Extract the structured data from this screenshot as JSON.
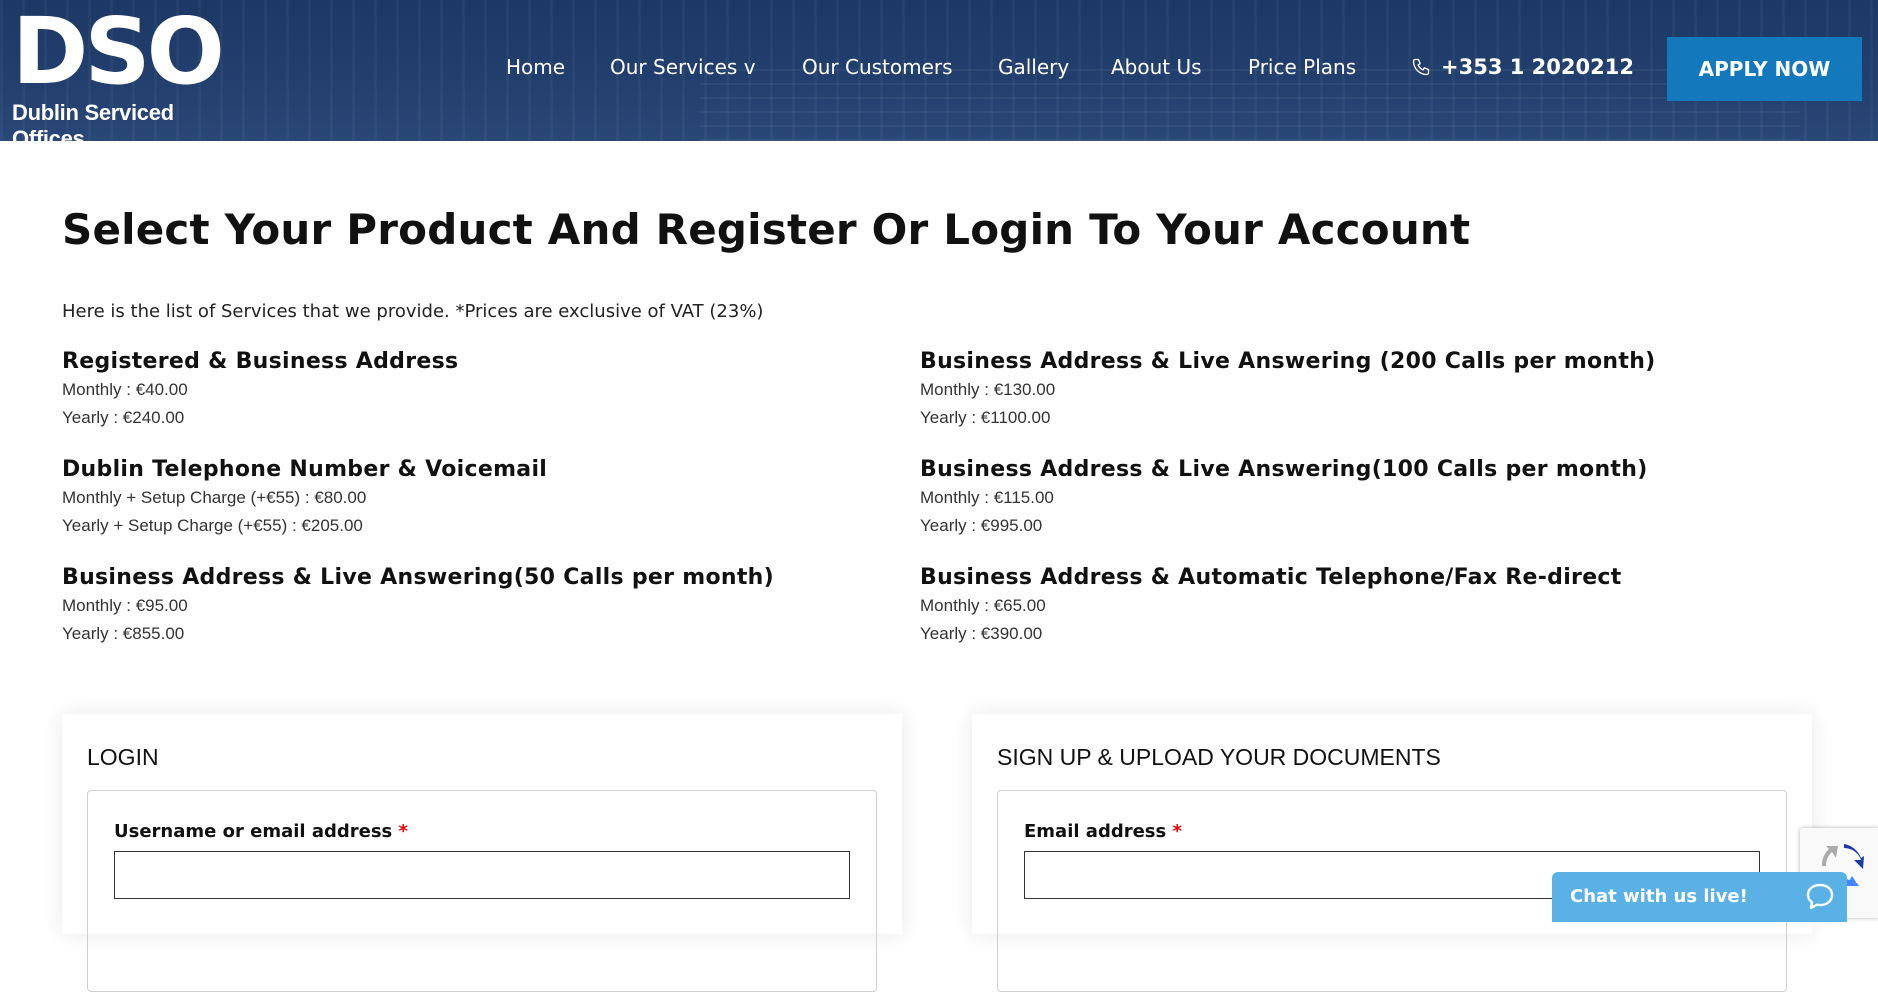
{
  "header": {
    "logo_mark": "DSO",
    "logo_text": "Dublin Serviced Offices",
    "nav": [
      {
        "label": "Home"
      },
      {
        "label": "Our Services v"
      },
      {
        "label": "Our Customers"
      },
      {
        "label": "Gallery"
      },
      {
        "label": "About Us"
      },
      {
        "label": "Price Plans"
      }
    ],
    "phone": "+353 1 2020212",
    "phone_icon": "phone-icon",
    "apply_label": "APPLY NOW"
  },
  "main": {
    "title": "Select Your Product And Register Or Login To Your Account",
    "intro": "Here is the list of Services that we provide. *Prices are exclusive of VAT (23%)",
    "services": [
      {
        "name": "Registered & Business Address",
        "monthly": "Monthly : €40.00",
        "yearly": "Yearly : €240.00"
      },
      {
        "name": "Business Address & Live Answering (200 Calls per month)",
        "monthly": "Monthly : €130.00",
        "yearly": "Yearly : €1100.00"
      },
      {
        "name": "Dublin Telephone Number & Voicemail",
        "monthly": "Monthly + Setup Charge (+€55) : €80.00",
        "yearly": "Yearly + Setup Charge (+€55) : €205.00"
      },
      {
        "name": "Business Address & Live Answering(100 Calls per month)",
        "monthly": "Monthly : €115.00",
        "yearly": "Yearly : €995.00"
      },
      {
        "name": "Business Address & Live Answering(50 Calls per month)",
        "monthly": "Monthly : €95.00",
        "yearly": "Yearly : €855.00"
      },
      {
        "name": "Business Address & Automatic Telephone/Fax Re-direct",
        "monthly": "Monthly : €65.00",
        "yearly": "Yearly : €390.00"
      }
    ]
  },
  "login": {
    "title": "LOGIN",
    "username_label": "Username or email address",
    "required_mark": "*",
    "username_value": ""
  },
  "signup": {
    "title": "SIGN UP & UPLOAD YOUR DOCUMENTS",
    "email_label": "Email address",
    "required_mark": "*",
    "email_value": ""
  },
  "chat": {
    "label": "Chat with us live!",
    "icon": "chat-bubble-icon"
  },
  "colors": {
    "header_bg": "#1d3864",
    "accent": "#1478bd",
    "chat_bg": "#5ab1e6",
    "required": "#e00000"
  }
}
